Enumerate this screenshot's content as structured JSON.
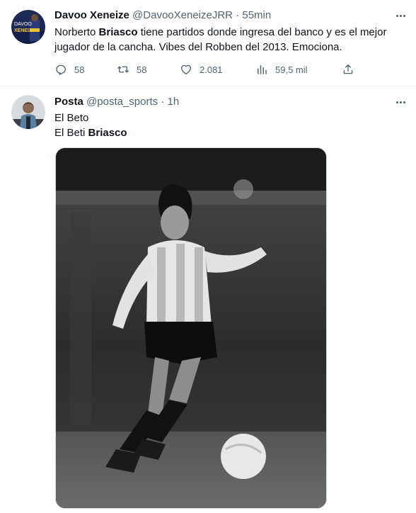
{
  "tweets": [
    {
      "name": "Davoo Xeneize",
      "handle": "@DavooXeneizeJRR",
      "separator": "·",
      "time": "55min",
      "text_parts": [
        "Norberto ",
        "Briasco",
        " tiene partidos donde ingresa del banco y es el mejor jugador de la cancha. Vibes del Robben del 2013. Emociona."
      ],
      "avatar_text_top": "DAVOO",
      "avatar_text_bottom": "XENEIZE",
      "actions": {
        "replies": "58",
        "retweets": "58",
        "likes": "2.081",
        "views": "59,5 mil"
      },
      "icons": [
        "reply-icon",
        "retweet-icon",
        "like-icon",
        "views-icon",
        "share-icon",
        "more-icon"
      ]
    },
    {
      "name": "Posta",
      "handle": "@posta_sports",
      "separator": "·",
      "time": "1h",
      "line1": "El Beto",
      "line2_prefix": "El Beti ",
      "line2_bold": "Briasco",
      "icons": [
        "more-icon"
      ]
    }
  ],
  "colors": {
    "text": "#0f1419",
    "secondary": "#536471",
    "divider": "#eff3f4"
  }
}
